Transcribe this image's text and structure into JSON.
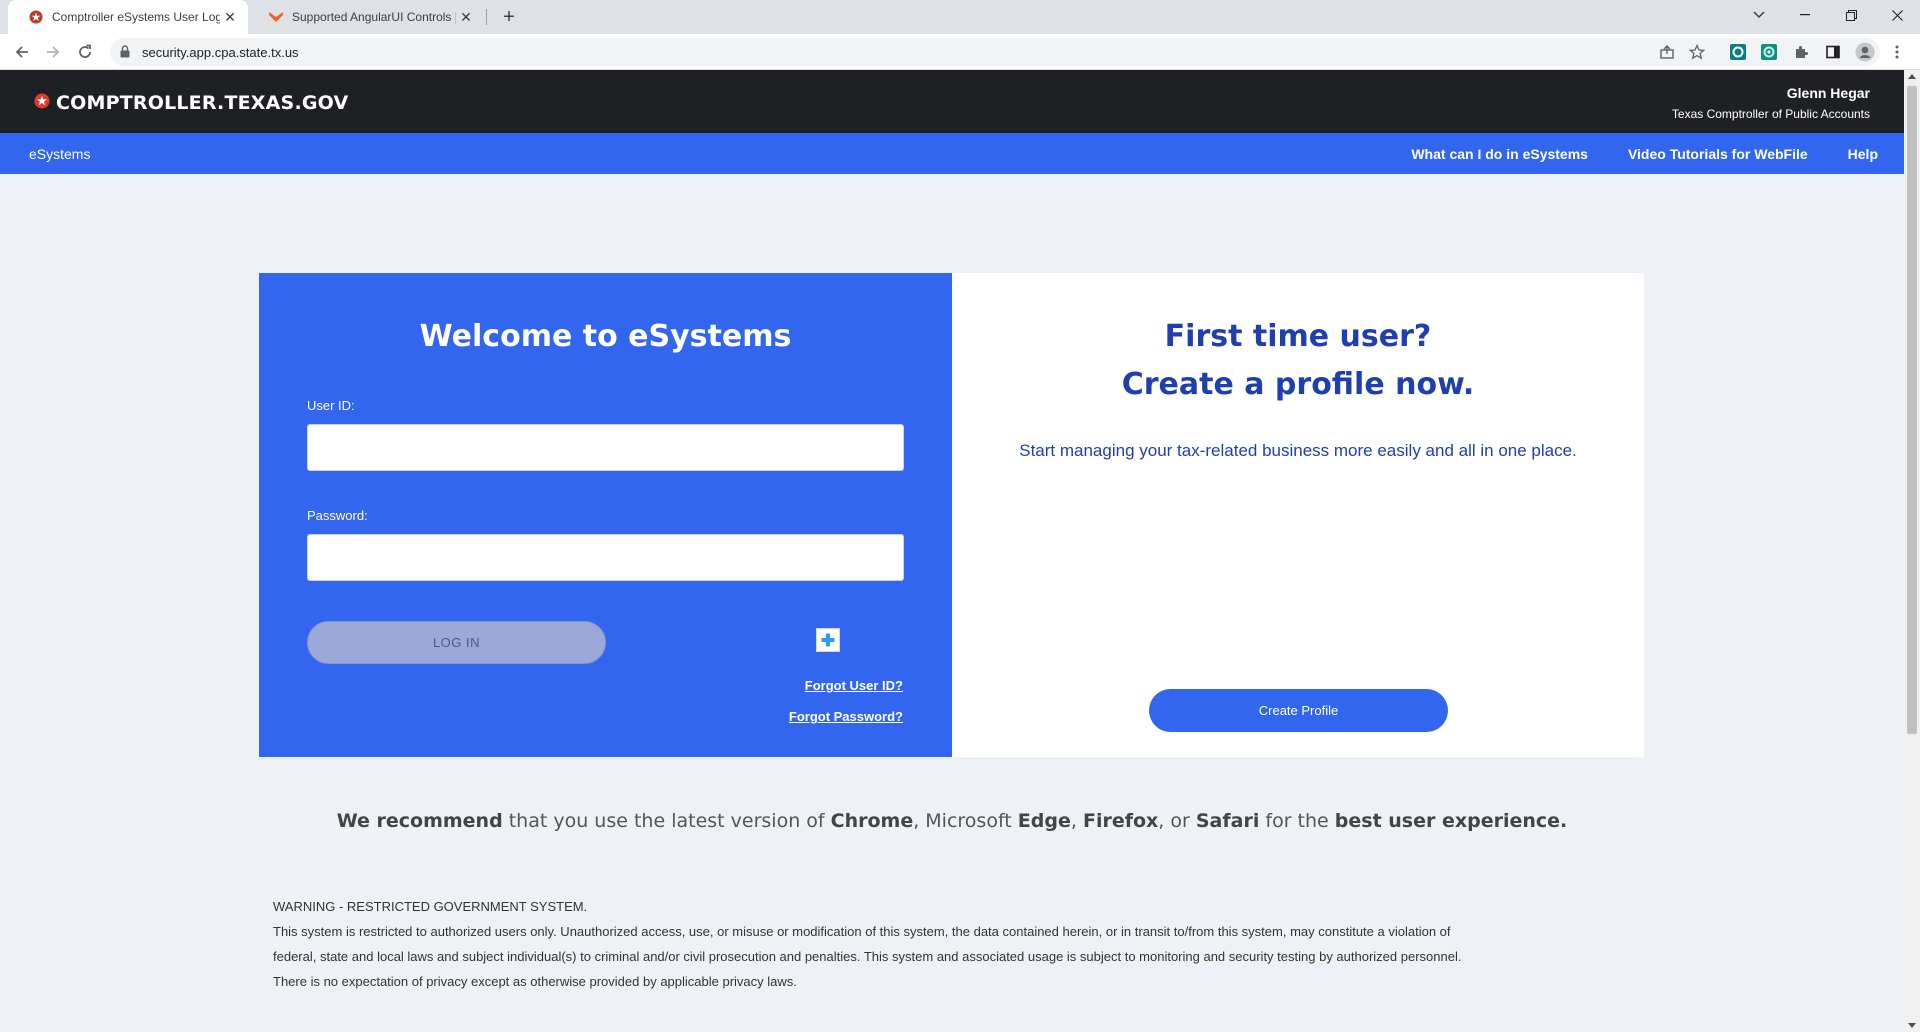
{
  "browser": {
    "tabs": [
      {
        "title": "Comptroller eSystems User Login",
        "active": true
      },
      {
        "title": "Supported AngularUI Controls | T",
        "active": false
      }
    ],
    "url": "security.app.cpa.state.tx.us"
  },
  "header": {
    "brand": "COMPTROLLER.TEXAS.GOV",
    "official_name": "Glenn Hegar",
    "official_title": "Texas Comptroller of Public Accounts"
  },
  "nav": {
    "home": "eSystems",
    "links": [
      "What can I do in eSystems",
      "Video Tutorials for WebFile",
      "Help"
    ]
  },
  "login": {
    "title": "Welcome to eSystems",
    "user_id_label": "User ID:",
    "user_id_value": "",
    "password_label": "Password:",
    "password_value": "",
    "login_button": "LOG IN",
    "forgot_user_id": "Forgot User ID?",
    "forgot_password": "Forgot Password?"
  },
  "profile": {
    "title_line1": "First time user?",
    "title_line2": "Create a profile now.",
    "description": "Start managing your tax-related business more easily and all in one place.",
    "button": "Create Profile"
  },
  "recommend": {
    "p1": "We recommend",
    "p2": " that you use the latest version of ",
    "p3": "Chrome",
    "p4": ", Microsoft ",
    "p5": "Edge",
    "p6": ", ",
    "p7": "Firefox",
    "p8": ", or ",
    "p9": "Safari",
    "p10": " for the ",
    "p11": "best user experience."
  },
  "warning": {
    "heading": "WARNING - RESTRICTED GOVERNMENT SYSTEM.",
    "line1": "This system is restricted to authorized users only. Unauthorized access, use, or misuse or modification of this system, the data contained herein, or in transit to/from this system, may constitute a violation of",
    "line2": "federal, state and local laws and subject individual(s) to criminal and/or civil prosecution and penalties. This system and associated usage is subject to monitoring and security testing by authorized personnel.",
    "line3": "There is no expectation of privacy except as otherwise provided by applicable privacy laws."
  },
  "colors": {
    "header_dark": "#1f2023",
    "brand_blue": "#3366ee",
    "title_blue": "#1f3fae",
    "star_red": "#e03a2e"
  }
}
